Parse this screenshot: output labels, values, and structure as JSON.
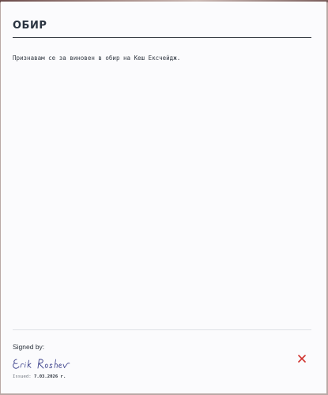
{
  "document": {
    "title": "ОБИР",
    "body": "Признавам се за виновен в обир на Кеш Ексчейдж."
  },
  "footer": {
    "signed_by_label": "Signed by:",
    "signature_name": "Erik Roshev",
    "issued_label": "Issued:",
    "issued_date": "7.03.2026 г."
  },
  "colors": {
    "sheet_background": "#fbfbfd",
    "title_text": "#2a3340",
    "signature_ink": "#3a3f8a",
    "close_icon": "#d0312d"
  },
  "icons": {
    "close": "close-icon"
  }
}
